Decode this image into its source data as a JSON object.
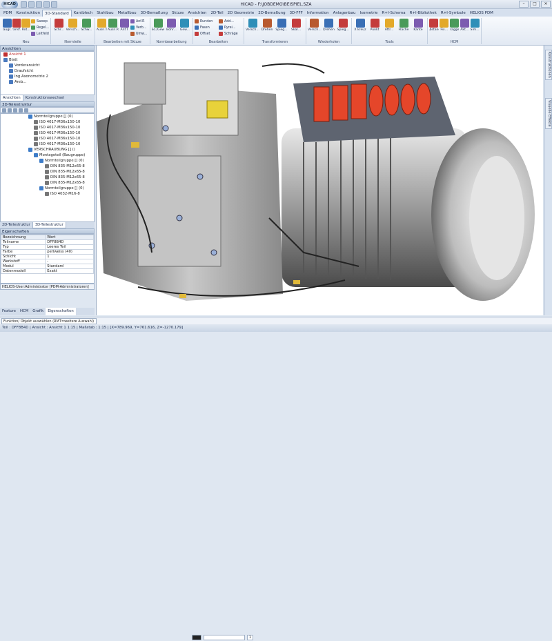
{
  "app": {
    "title": "HICAD - F:\\JOBDEMO\\BEISPIEL.SZA",
    "menu_button": "HICAD"
  },
  "tabs": [
    "PDM",
    "Konstruktion",
    "3D-Standard",
    "Kantblech",
    "Stahlbau",
    "Metallbau",
    "3D-Bemaßung",
    "Skizze",
    "Ansichten",
    "2D-Teil",
    "2D Geometrie",
    "2D-Bemaßung",
    "3D-FFF",
    "Information",
    "Anlagenbau",
    "Isometrie",
    "R+I-Schema",
    "R+I-Bibliothek",
    "R+I-Symbole",
    "HELIOS PDM"
  ],
  "active_tab": "3D-Standard",
  "ribbon": {
    "groups": [
      {
        "label": "Neu",
        "buttons": [
          "Baugr...",
          "Transf...",
          "Rot..."
        ],
        "stack": [
          "Sweep",
          "Regel...",
          "Leitfeld"
        ]
      },
      {
        "label": "Normteile",
        "buttons": [
          "Schr...",
          "Versch...",
          "Schw..."
        ],
        "stack": []
      },
      {
        "label": "Bearbeiten mit Skizze",
        "buttons": [
          "Ausn.T",
          "Ausn.R",
          "Anf.T"
        ],
        "stack": [
          "Anf.R",
          "Verb...",
          "Umw..."
        ]
      },
      {
        "label": "Normbearbeitung",
        "buttons": [
          "Bo./Gew.",
          "Bohr...",
          "Gew..."
        ],
        "stack": []
      },
      {
        "label": "Bearbeiten",
        "buttons": [],
        "stack": [
          "Runden",
          "Fasen",
          "Offset"
        ],
        "stack2": [
          "Add...",
          "Pyrei...",
          "Schräge"
        ]
      },
      {
        "label": "Transformieren",
        "buttons": [
          "Versch...",
          "Drehen",
          "Spieg...",
          "Skal..."
        ],
        "stack": []
      },
      {
        "label": "Wiederholen",
        "buttons": [
          "Versch...",
          "Drehen",
          "Spieg..."
        ],
        "stack": []
      },
      {
        "label": "Tools",
        "buttons": [
          "X kreuz",
          "Punkt",
          "Attr...",
          "Fläche",
          "Kante"
        ],
        "stack": []
      },
      {
        "label": "HCM",
        "buttons": [
          "Abstand",
          "Fix...",
          "Draggen",
          "Akt...",
          "Sim..."
        ],
        "stack": []
      }
    ]
  },
  "views_panel": {
    "title": "Ansichten",
    "items": [
      "Ansicht 1",
      "Blatt",
      "Vorderansicht",
      "Draufsicht",
      "Ing.Axonometrie 2",
      "Areb..."
    ],
    "tabs": [
      "Ansichten",
      "Konstruktionswechsel"
    ]
  },
  "tree_panel": {
    "title": "3D-Teilestruktur",
    "items": [
      {
        "label": "Normteilgruppe [] (0)",
        "level": 0
      },
      {
        "label": "ISO 4017-M36x150-10",
        "level": 1
      },
      {
        "label": "ISO 4017-M36x150-10",
        "level": 1
      },
      {
        "label": "ISO 4017-M36x150-10",
        "level": 1
      },
      {
        "label": "ISO 4017-M36x150-10",
        "level": 1
      },
      {
        "label": "ISO 4017-M36x150-10",
        "level": 1
      },
      {
        "label": "VERSCHRAUBUNG [] ()",
        "level": 0
      },
      {
        "label": "Montageteil (Baugruppe)",
        "level": 1
      },
      {
        "label": "Normteilgruppe [] (0)",
        "level": 2
      },
      {
        "label": "DIN 835-M12x65-8",
        "level": 3
      },
      {
        "label": "DIN 835-M12x65-8",
        "level": 3
      },
      {
        "label": "DIN 835-M12x65-8",
        "level": 3
      },
      {
        "label": "DIN 835-M12x65-8",
        "level": 3
      },
      {
        "label": "Normteilgruppe [] (0)",
        "level": 2
      },
      {
        "label": "ISO 4032-M16-8",
        "level": 3
      }
    ],
    "tabs": [
      "2D-Teilestruktur",
      "3D-Teilestruktur"
    ]
  },
  "props_panel": {
    "title": "Eigenschaften",
    "header": [
      "Bezeichnung",
      "Wert"
    ],
    "rows": [
      [
        "Teilname",
        "DFF8B4D"
      ],
      [
        "Typ",
        "Leeres Teil"
      ],
      [
        "Farbe",
        "perlweiss (40)"
      ],
      [
        "Schicht",
        "1"
      ],
      [
        "Werkstoff",
        "-"
      ],
      [
        "Modul",
        "Standard"
      ],
      [
        "Datenmodell",
        "Exakt"
      ]
    ],
    "user": "HELIOS-User:Administrator [PDM-Administratoren]"
  },
  "bottom_tabs": [
    "Feature",
    "HCM",
    "Grafik",
    "Eigenschaften"
  ],
  "right_tabs": [
    "Konstruktionen",
    "Visuelle Effekte"
  ],
  "command_prompt": "Funktion/ Objekt auswählen (RMT=weitere Auswahl)",
  "viewport_bar": {
    "layer": "1"
  },
  "status": "Teil : DFF8B4D | Ansicht : Ansicht 1 1:15 | Maßstab : 1:15 | [X=789.969, Y=761.616, Z=-1270.179]"
}
